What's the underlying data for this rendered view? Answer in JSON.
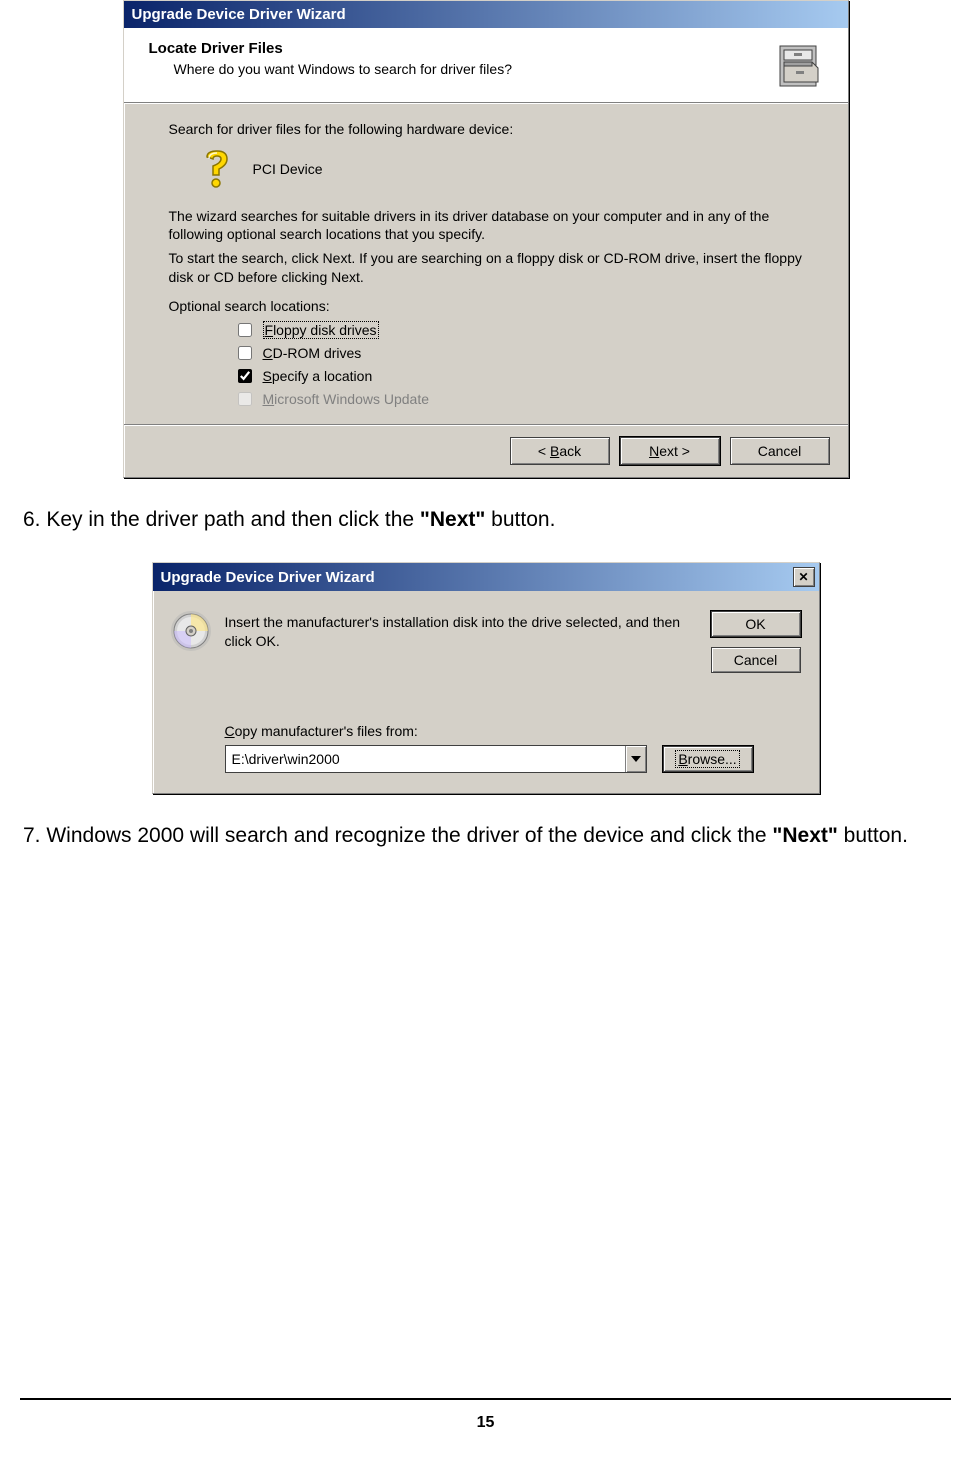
{
  "dialog1": {
    "title": "Upgrade Device Driver Wizard",
    "header_title": "Locate Driver Files",
    "header_sub": "Where do you want Windows to search for driver files?",
    "search_prompt": "Search for driver files for the following hardware device:",
    "device_name": "PCI Device",
    "para1": "The wizard searches for suitable drivers in its driver database on your computer and in any of the following optional search locations that you specify.",
    "para2": "To start the search, click Next. If you are searching on a floppy disk or CD-ROM drive, insert the floppy disk or CD before clicking Next.",
    "optional_label": "Optional search locations:",
    "checks": {
      "floppy": "Floppy disk drives",
      "cdrom": "CD-ROM drives",
      "specify": "Specify a location",
      "msupdate": "Microsoft Windows Update"
    },
    "buttons": {
      "back": "< Back",
      "next": "Next >",
      "cancel": "Cancel"
    }
  },
  "step6_prefix": "6. Key in the driver path and then click the ",
  "step6_bold": "\"Next\"",
  "step6_suffix": " button.",
  "dialog2": {
    "title": "Upgrade Device Driver Wizard",
    "msg": "Insert the manufacturer's installation disk into the drive selected, and then click OK.",
    "ok": "OK",
    "cancel": "Cancel",
    "copy_label": "Copy manufacturer's files from:",
    "path_value": "E:\\driver\\win2000",
    "browse": "Browse..."
  },
  "step7_prefix": "7. Windows 2000 will search and recognize the driver of the device and click the ",
  "step7_bold": "\"Next\"",
  "step7_suffix": " button.",
  "page_number": "15"
}
